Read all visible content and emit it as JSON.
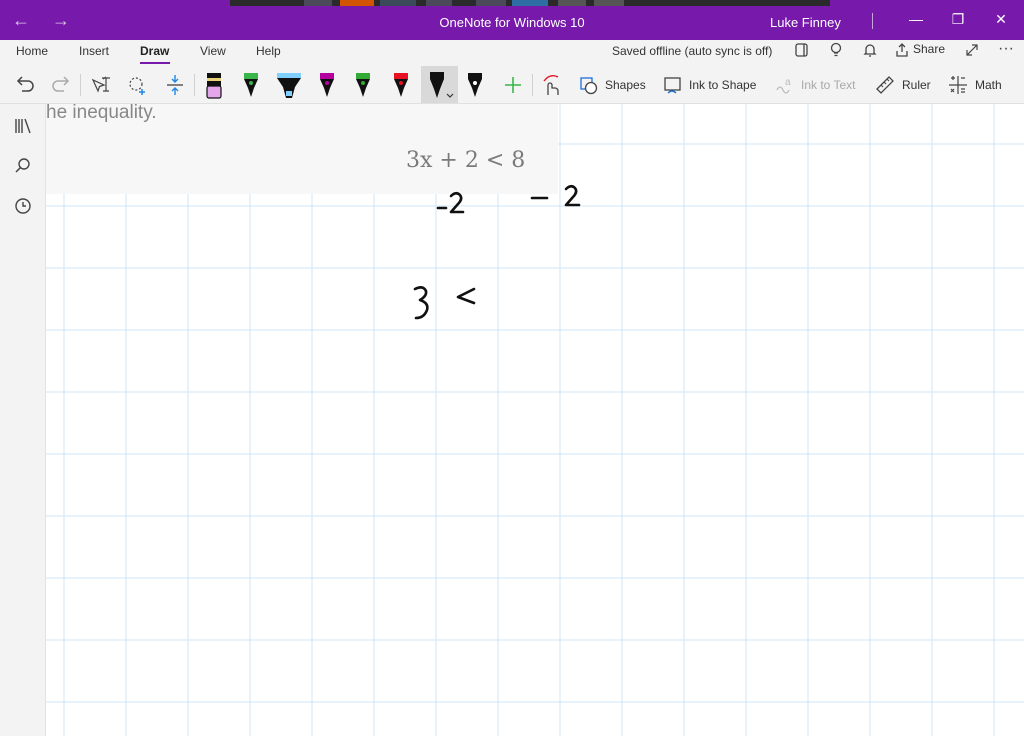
{
  "window": {
    "title": "OneNote for Windows 10",
    "user": "Luke Finney"
  },
  "tabs": [
    {
      "label": "Home"
    },
    {
      "label": "Insert"
    },
    {
      "label": "Draw",
      "active": true
    },
    {
      "label": "View"
    },
    {
      "label": "Help"
    }
  ],
  "status": {
    "sync_text": "Saved offline (auto sync is off)"
  },
  "header_actions": {
    "share_label": "Share"
  },
  "toolbar": {
    "shapes_label": "Shapes",
    "ink_to_shape_label": "Ink to Shape",
    "ink_to_text_label": "Ink to Text",
    "ruler_label": "Ruler",
    "math_label": "Math",
    "pens": [
      {
        "name": "eraser",
        "color": "#e3a6e8"
      },
      {
        "name": "pen-green",
        "color": "#39b54a"
      },
      {
        "name": "highlighter-blue",
        "color": "#7fd0ff"
      },
      {
        "name": "pen-purple",
        "color": "#b4009e"
      },
      {
        "name": "pen-green-2",
        "color": "#33aa33"
      },
      {
        "name": "pen-red",
        "color": "#e81123"
      },
      {
        "name": "pen-black-selected",
        "color": "#111111"
      },
      {
        "name": "pen-black",
        "color": "#111111"
      }
    ]
  },
  "sidebar": {
    "icons": [
      "notebooks-icon",
      "search-icon",
      "recent-icon"
    ]
  },
  "page": {
    "pasted_text": "he inequality.",
    "pasted_equation": "3x + 2 < 8",
    "ink": [
      {
        "text": "-2"
      },
      {
        "text": "- 2"
      },
      {
        "text": "3 <"
      }
    ]
  },
  "colors": {
    "accent": "#7719aa",
    "grid_line": "#cfe6f7"
  }
}
